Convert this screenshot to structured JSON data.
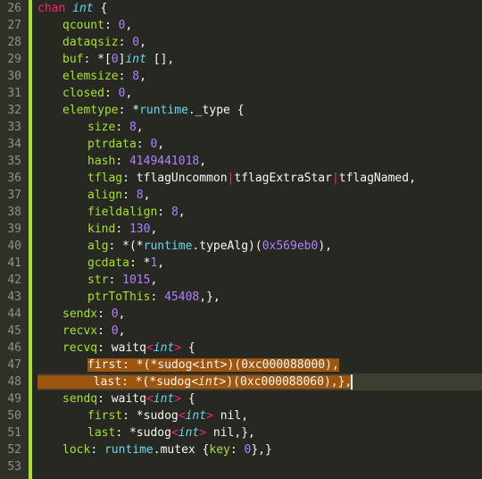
{
  "lineNumbers": [
    "26",
    "27",
    "28",
    "29",
    "30",
    "31",
    "32",
    "33",
    "34",
    "35",
    "36",
    "37",
    "38",
    "39",
    "40",
    "41",
    "42",
    "43",
    "44",
    "45",
    "46",
    "47",
    "48",
    "49",
    "50",
    "51",
    "52",
    "53"
  ],
  "code": {
    "l26": {
      "kw": "chan",
      "type": "int",
      "brace": " {"
    },
    "l27": {
      "prop": "qcount",
      "val": "0"
    },
    "l28": {
      "prop": "dataqsiz",
      "val": "0"
    },
    "l29": {
      "prop": "buf",
      "pre": "*[",
      "idx": "0",
      "post": "]",
      "type": "int",
      "arr": " []"
    },
    "l30": {
      "prop": "elemsize",
      "val": "8"
    },
    "l31": {
      "prop": "closed",
      "val": "0"
    },
    "l32": {
      "prop": "elemtype",
      "pre": "*",
      "pkg": "runtime",
      "dot": ".",
      "type": "_type",
      "brace": " {"
    },
    "l33": {
      "prop": "size",
      "val": "8"
    },
    "l34": {
      "prop": "ptrdata",
      "val": "0"
    },
    "l35": {
      "prop": "hash",
      "val": "4149441018"
    },
    "l36": {
      "prop": "tflag",
      "v1": "tflagUncommon",
      "v2": "tflagExtraStar",
      "v3": "tflagNamed"
    },
    "l37": {
      "prop": "align",
      "val": "8"
    },
    "l38": {
      "prop": "fieldalign",
      "val": "8"
    },
    "l39": {
      "prop": "kind",
      "val": "130"
    },
    "l40": {
      "prop": "alg",
      "pre": "*(*",
      "pkg": "runtime",
      "dot": ".",
      "type": "typeAlg",
      "mid": ")(",
      "val": "0x569eb0",
      "post": ")"
    },
    "l41": {
      "prop": "gcdata",
      "pre": "*",
      "val": "1"
    },
    "l42": {
      "prop": "str",
      "val": "1015"
    },
    "l43": {
      "prop": "ptrToThis",
      "val": "45408",
      "post": ",},"
    },
    "l44": {
      "prop": "sendx",
      "val": "0"
    },
    "l45": {
      "prop": "recvx",
      "val": "0"
    },
    "l46": {
      "prop": "recvq",
      "type1": "waitq",
      "lt": "<",
      "type2": "int",
      "gt": ">",
      "brace": " {"
    },
    "l47": {
      "prop": "first",
      "full": ": *(*sudog<int>)(0xc000088000),",
      "pre": "*(*",
      "type": "sudog",
      "lt": "<",
      "inner": "int",
      "gt": ">",
      "mid": ")(",
      "val": "0xc000088000",
      "post": "),"
    },
    "l48": {
      "prop": "last",
      "pre": ": *(*",
      "type": "sudog",
      "lt": "<",
      "inner": "int",
      "gt": ">)(",
      "val": "0xc000088060",
      "post": "),},"
    },
    "l49": {
      "prop": "sendq",
      "type1": "waitq",
      "lt": "<",
      "type2": "int",
      "gt": ">",
      "brace": " {"
    },
    "l50": {
      "prop": "first",
      "pre": "*",
      "type": "sudog",
      "lt": "<",
      "inner": "int",
      "gt": ">",
      "nil": " nil"
    },
    "l51": {
      "prop": "last",
      "pre": "*",
      "type": "sudog",
      "lt": "<",
      "inner": "int",
      "gt": ">",
      "nil": " nil",
      "post": ",},"
    },
    "l52": {
      "prop": "lock",
      "pkg": "runtime",
      "dot": ".",
      "type": "mutex",
      "brace": " {",
      "key": "key",
      "val": "0",
      "post": "},}"
    },
    "l53": {}
  }
}
